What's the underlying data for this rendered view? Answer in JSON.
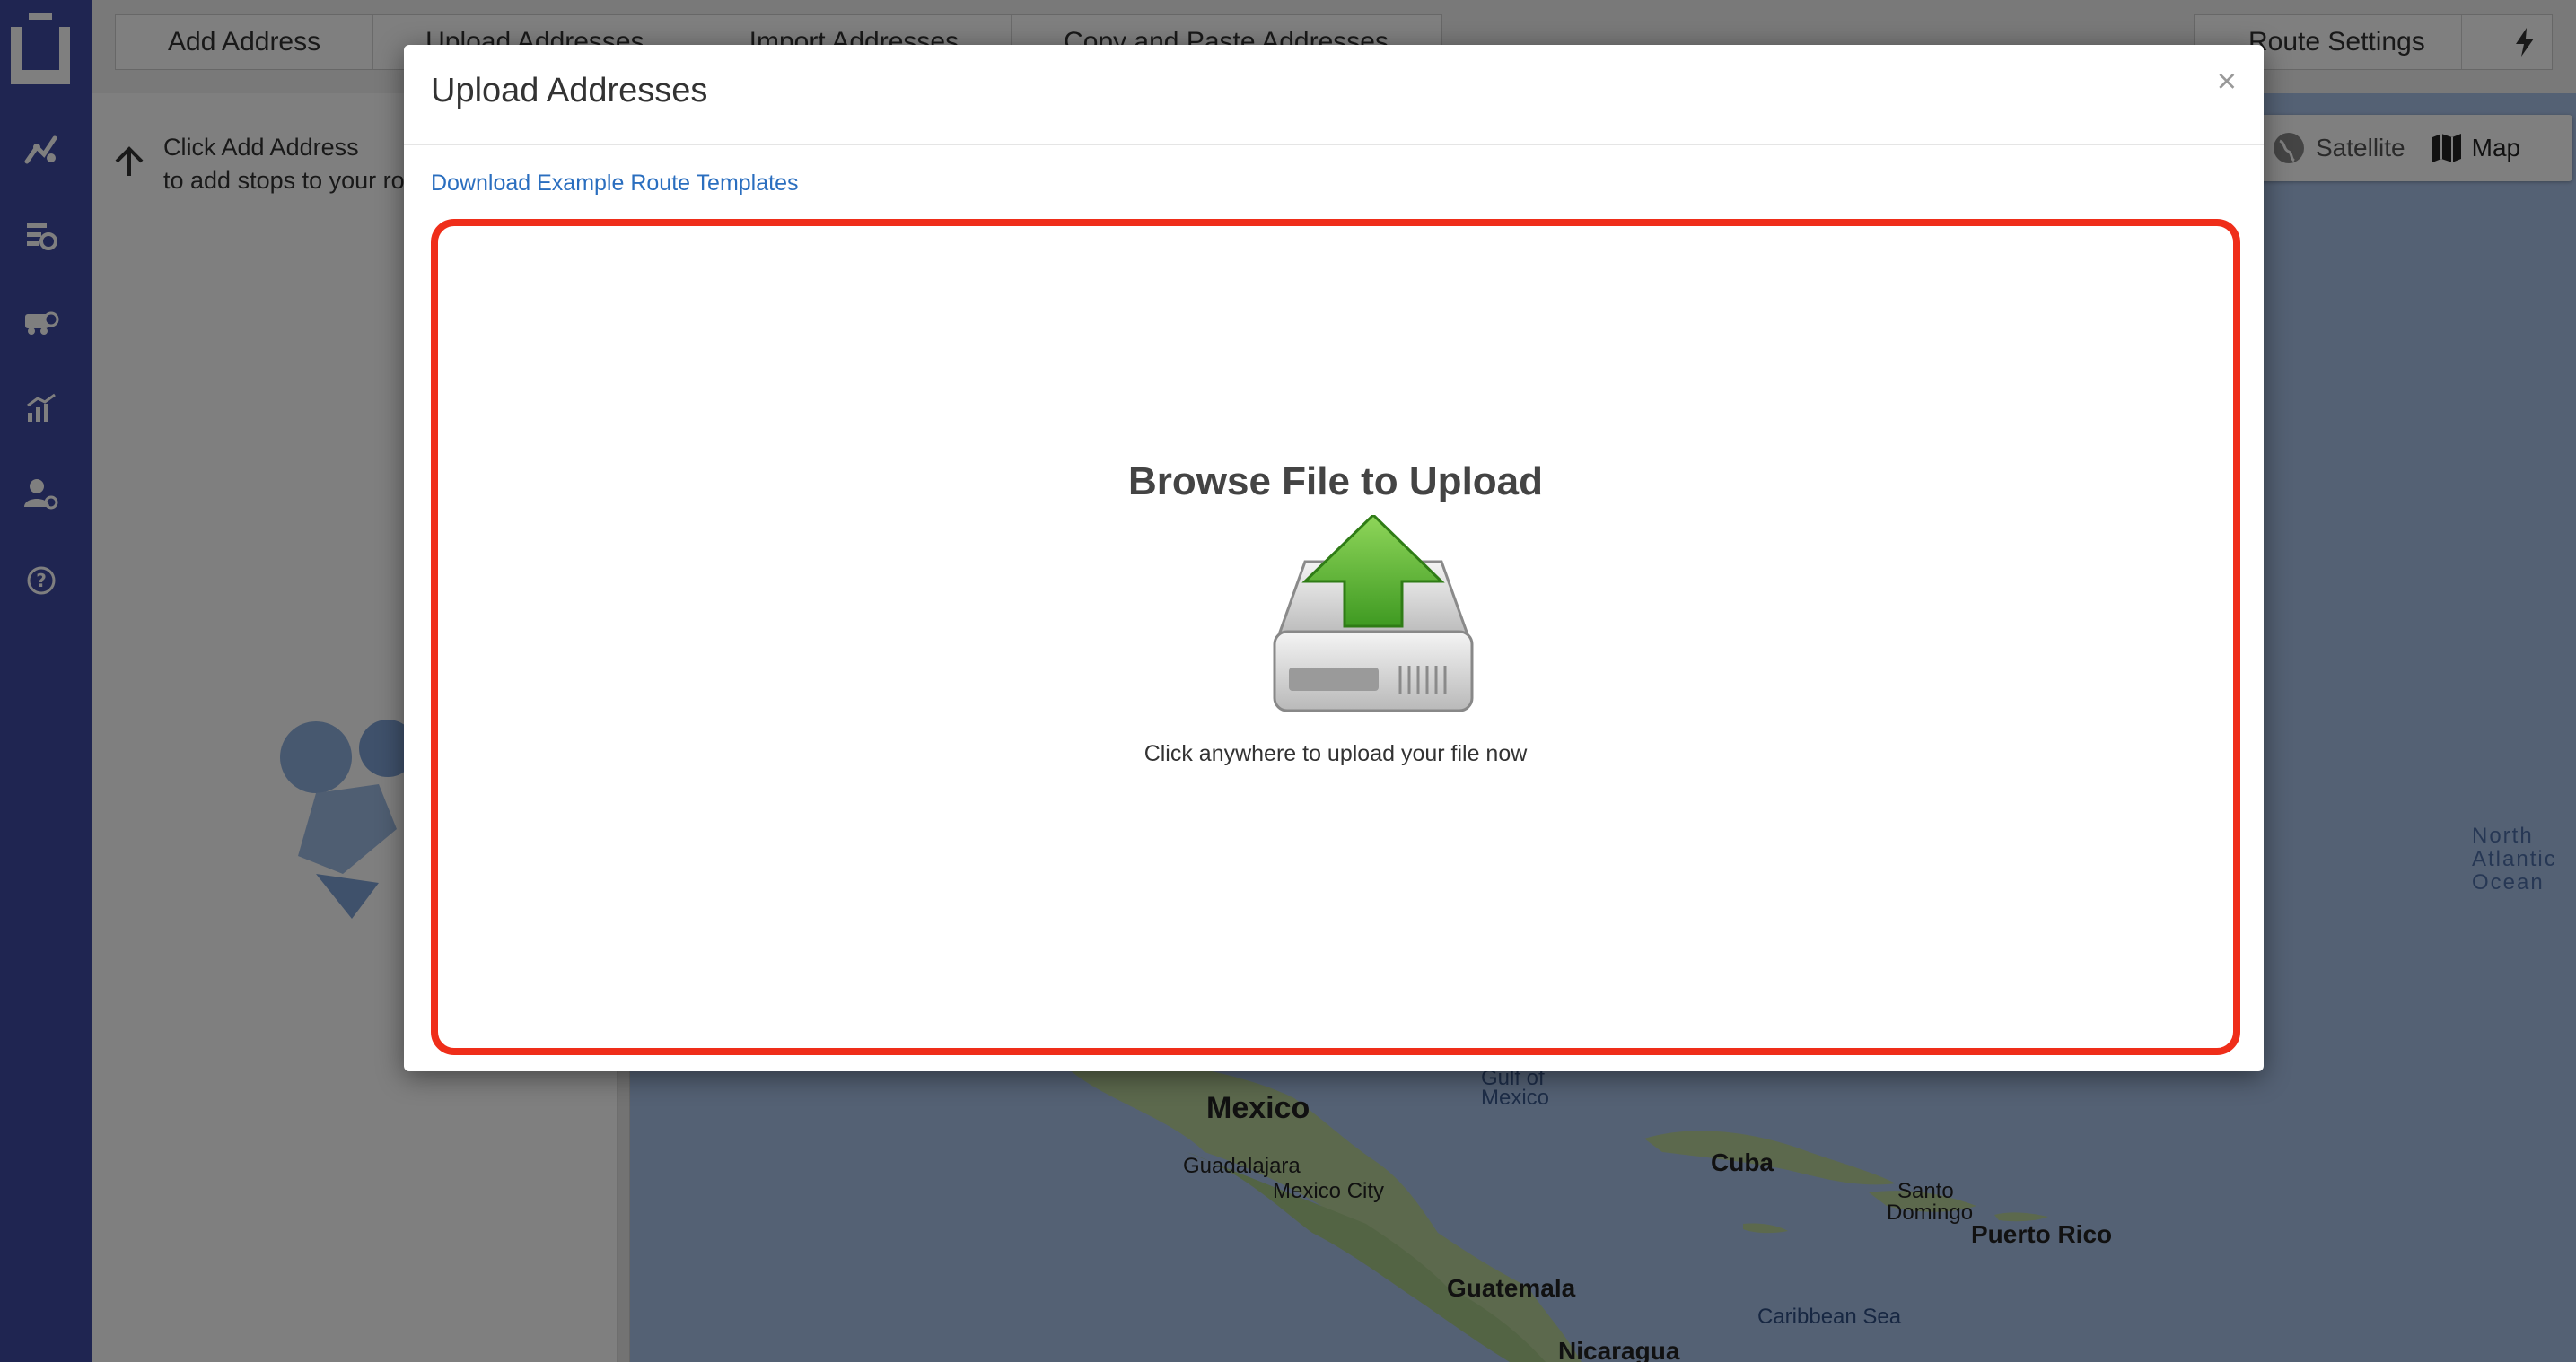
{
  "colors": {
    "nav_bg": "#3f4aa2",
    "accent_link": "#2a6ebf",
    "highlight_border": "#ef2e1a",
    "upload_arrow": "#5fb33a"
  },
  "nav": {
    "items": [
      {
        "icon": "route-planner-icon"
      },
      {
        "icon": "route-settings-icon"
      },
      {
        "icon": "fleet-icon"
      },
      {
        "icon": "analytics-icon"
      },
      {
        "icon": "user-settings-icon"
      },
      {
        "icon": "help-icon"
      }
    ]
  },
  "toolbar": {
    "buttons": [
      "Add Address",
      "Upload Addresses",
      "Import Addresses",
      "Copy and Paste Addresses"
    ],
    "route_settings": "Route Settings"
  },
  "left_panel": {
    "hint_line1": "Click Add Address",
    "hint_line2": "to add stops to your route"
  },
  "map": {
    "view_options": [
      "Satellite",
      "Map"
    ],
    "selected_view": "Map",
    "labels": {
      "mexico": "Mexico",
      "guadalajara": "Guadalajara",
      "mexico_city": "Mexico City",
      "cuba": "Cuba",
      "santo": "Santo",
      "domingo": "Domingo",
      "puerto_rico": "Puerto Rico",
      "guatemala": "Guatemala",
      "nicaragua": "Nicaragua",
      "caribbean_sea": "Caribbean Sea",
      "gulf_of": "Gulf of",
      "gulf_mexico": "Mexico",
      "north": "North",
      "atlantic": "Atlantic",
      "ocean": "Ocean"
    }
  },
  "modal": {
    "title": "Upload Addresses",
    "close_label": "×",
    "template_link": "Download Example Route Templates",
    "dropzone_title": "Browse File to Upload",
    "dropzone_subtitle": "Click anywhere to upload your file now"
  }
}
